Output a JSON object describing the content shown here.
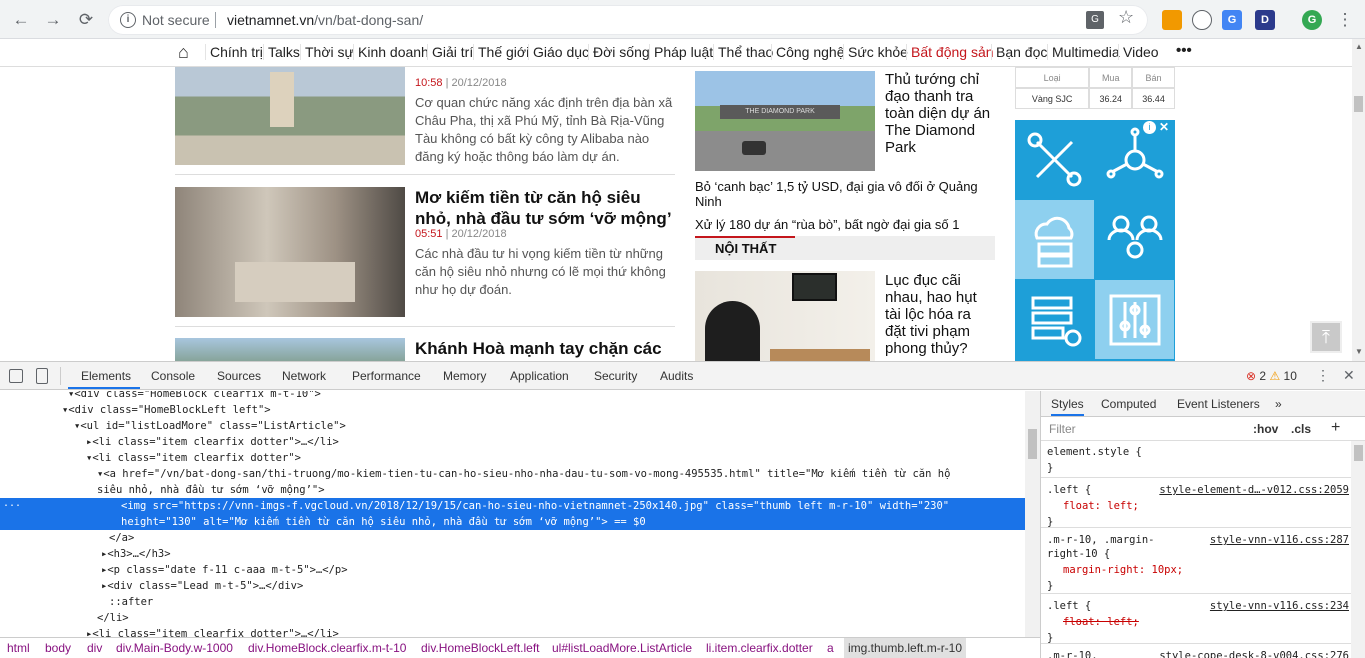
{
  "browser": {
    "not_secure": "Not secure",
    "url_host": "vietnamnet.vn",
    "url_path": "/vn/bat-dong-san/",
    "avatar_letter": "G",
    "ext_d_letter": "D"
  },
  "site_nav": {
    "items": [
      "Chính trị",
      "Talks",
      "Thời sự",
      "Kinh doanh",
      "Giải trí",
      "Thế giới",
      "Giáo dục",
      "Đời sống",
      "Pháp luật",
      "Thể thao",
      "Công nghệ",
      "Sức khỏe",
      "Bất động sản",
      "Bạn đọc",
      "Multimedia",
      "Video"
    ],
    "more": "•••"
  },
  "articles": [
    {
      "date": "10:58",
      "day": "| 20/12/2018",
      "lead": "Cơ quan chức năng xác định trên địa bàn xã Châu Pha, thị xã Phú Mỹ, tỉnh Bà Rịa-Vũng Tàu không có bất kỳ công ty Alibaba nào đăng ký hoặc thông báo làm dự án."
    },
    {
      "title": "Mơ kiếm tiền từ căn hộ siêu nhỏ, nhà đầu tư sớm ‘vỡ mộng’",
      "date": "05:51",
      "day": "| 20/12/2018",
      "lead": "Các nhà đầu tư hi vọng kiếm tiền từ những căn hộ siêu nhỏ nhưng có lẽ mọi thứ không như họ dự đoán."
    },
    {
      "title": "Khánh Hoà mạnh tay chặn các dự án BĐS..."
    }
  ],
  "side": {
    "feature_title": "Thủ tướng chỉ đạo thanh tra toàn diện dự án The Diamond Park",
    "diamond_sign": "THE DIAMOND PARK",
    "link1": "Bỏ ‘canh bạc’ 1,5 tỷ USD, đại gia vô đối ở Quảng Ninh",
    "link2": "Xử lý 180 dự án “rùa bò”, bất ngờ đại gia số 1",
    "section": "NỘI THẤT",
    "feature2_title": "Lục đục cãi nhau, hao hụt tài lộc hóa ra đặt tivi phạm phong thủy?"
  },
  "gold": {
    "headers": [
      "Loại",
      "Mua",
      "Bán"
    ],
    "row": [
      "Vàng SJC",
      "36.24",
      "36.44"
    ]
  },
  "devtools": {
    "tabs": [
      "Elements",
      "Console",
      "Sources",
      "Network",
      "Performance",
      "Memory",
      "Application",
      "Security",
      "Audits"
    ],
    "errors": "2",
    "warnings": "10",
    "lines": [
      {
        "i": 70,
        "t": "▾<div class=\"HomeBlock clearfix m-t-10\">"
      },
      {
        "i": 64,
        "t": "▾<div class=\"HomeBlockLeft left\">"
      },
      {
        "i": 76,
        "t": "▾<ul id=\"listLoadMore\" class=\"ListArticle\">"
      },
      {
        "i": 88,
        "t": "▸<li class=\"item clearfix dotter\">…</li>"
      },
      {
        "i": 88,
        "t": "▾<li class=\"item clearfix dotter\">"
      },
      {
        "i": 99,
        "t": "▾<a href=\"/vn/bat-dong-san/thi-truong/mo-kiem-tien-tu-can-ho-sieu-nho-nha-dau-tu-som-vo-mong-495535.html\" title=\"Mơ kiếm tiền từ căn hộ"
      },
      {
        "i": 99,
        "t": "siêu nhỏ, nhà đầu tư sớm ‘vỡ mộng’\">"
      },
      {
        "i": 123,
        "t": "<img src=\"https://vnn-imgs-f.vgcloud.vn/2018/12/19/15/can-ho-sieu-nho-vietnamnet-250x140.jpg\" class=\"thumb left m-r-10\" width=\"230\""
      },
      {
        "i": 123,
        "t": "height=\"130\" alt=\"Mơ kiếm tiền từ căn hộ siêu nhỏ, nhà đầu tư sớm ‘vỡ mộng’\"> == $0"
      },
      {
        "i": 111,
        "t": "</a>"
      },
      {
        "i": 103,
        "t": "▸<h3>…</h3>"
      },
      {
        "i": 103,
        "t": "▸<p class=\"date f-11 c-aaa m-t-5\">…</p>"
      },
      {
        "i": 103,
        "t": "▸<div class=\"Lead m-t-5\">…</div>"
      },
      {
        "i": 111,
        "t": "::after"
      },
      {
        "i": 99,
        "t": "</li>"
      },
      {
        "i": 88,
        "t": "▸<li class=\"item clearfix dotter\">…</li>"
      }
    ],
    "sel_marker": "...",
    "crumbs": [
      "html",
      "body",
      "div",
      "div.Main-Body.w-1000",
      "div.HomeBlock.clearfix.m-t-10",
      "div.HomeBlockLeft.left",
      "ul#listLoadMore.ListArticle",
      "li.item.clearfix.dotter",
      "a",
      "img.thumb.left.m-r-10"
    ],
    "style_tabs": [
      "Styles",
      "Computed",
      "Event Listeners",
      "»"
    ],
    "filter_placeholder": "Filter",
    "hov": ":hov",
    "cls": ".cls",
    "plus": "+",
    "rules": [
      {
        "sel": "element.style {",
        "src": "",
        "props": [],
        "close": "}"
      },
      {
        "sel": ".left {",
        "src": "style-element-d…-v012.css:2059",
        "props": [
          "float: left;"
        ],
        "close": "}"
      },
      {
        "sel": ".m-r-10, .margin-",
        "sel2": "right-10 {",
        "src": "style-vnn-v116.css:287",
        "props": [
          "margin-right: 10px;"
        ],
        "close": "}"
      },
      {
        "sel": ".left {",
        "src": "style-vnn-v116.css:234",
        "props": [
          "float: left;"
        ],
        "close": "}"
      },
      {
        "sel": ".m-r-10,",
        "src": "style-cope-desk-8-v004.css:276",
        "props": [],
        "close": ""
      }
    ]
  }
}
